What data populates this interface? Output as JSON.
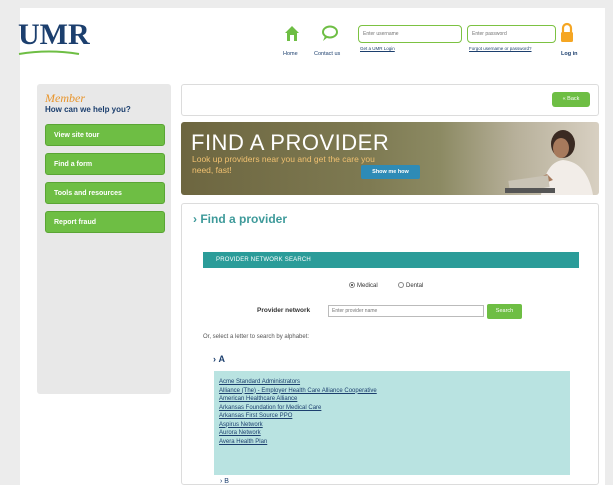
{
  "header": {
    "logo_text": "UMR",
    "home_label": "Home",
    "contact_label": "Contact us",
    "username_placeholder": "Enter username",
    "password_placeholder": "Enter password",
    "forgot_username": "Get a UMR Login",
    "forgot_password": "Forgot username or password?",
    "login_label": "Log in",
    "brand_color": "#1c3f6e",
    "accent_color": "#6ebe44"
  },
  "sidebar": {
    "member_label": "Member",
    "help_label": "How can we help you?",
    "buttons": [
      "View site tour",
      "Find a form",
      "Tools and resources",
      "Report fraud"
    ]
  },
  "topbar": {
    "back_label": "« Back"
  },
  "banner": {
    "title": "FIND A PROVIDER",
    "subtitle": "Look up providers near you and get the care you need, fast!",
    "button": "Show me how"
  },
  "main": {
    "title": "Find a provider",
    "search_header": "PROVIDER NETWORK SEARCH",
    "radio_medical": "Medical",
    "radio_dental": "Dental",
    "network_label": "Provider network",
    "network_placeholder": "Enter provider name",
    "search_button": "Search",
    "alpha_note": "Or, select a letter to search by alphabet:",
    "letter_a": "A",
    "providers_a": [
      "Acme Standard Administrators",
      "Alliance (The) - Employer Health Care Alliance Cooperative",
      "American Healthcare Alliance",
      "Arkansas Foundation for Medical Care",
      "Arkansas First Source PPO",
      "Aspirus Network",
      "Aurora Network",
      "Avera Health Plan"
    ],
    "letter_b": "B",
    "section_color": "#2b9c99"
  }
}
